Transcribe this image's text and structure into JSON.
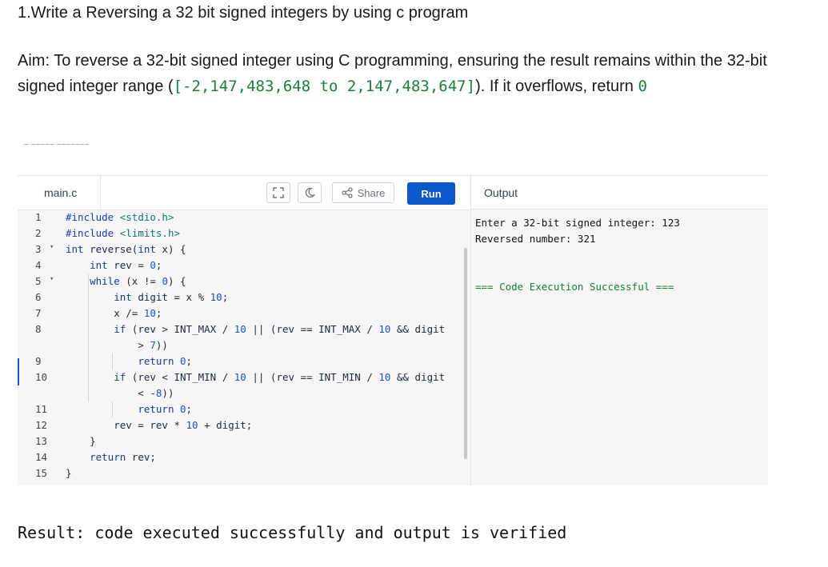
{
  "title": "1.Write a Reversing a 32 bit signed integers by using c program",
  "aim": {
    "prefix": "Aim: To reverse a 32-bit signed integer using C programming, ensuring the result remains within the 32-bit signed integer range (",
    "range_code": "[-2,147,483,648 to 2,147,483,647]",
    "middle": "). If it overflows, return ",
    "return_code": "0"
  },
  "editor": {
    "file_tab": "main.c",
    "share_label": "Share",
    "run_label": "Run",
    "output_label": "Output"
  },
  "code_lines": [
    {
      "n": "1",
      "text": "#include <stdio.h>"
    },
    {
      "n": "2",
      "text": "#include <limits.h>"
    },
    {
      "n": "3",
      "text": "int reverse(int x) {"
    },
    {
      "n": "4",
      "text": "    int rev = 0;"
    },
    {
      "n": "5",
      "text": "    while (x != 0) {"
    },
    {
      "n": "6",
      "text": "        int digit = x % 10;"
    },
    {
      "n": "7",
      "text": "        x /= 10;"
    },
    {
      "n": "8",
      "text": "        if (rev > INT_MAX / 10 || (rev == INT_MAX / 10 && digit"
    },
    {
      "n": "",
      "text": "            > 7))"
    },
    {
      "n": "9",
      "text": "            return 0;"
    },
    {
      "n": "10",
      "text": "        if (rev < INT_MIN / 10 || (rev == INT_MIN / 10 && digit"
    },
    {
      "n": "",
      "text": "            < -8))"
    },
    {
      "n": "11",
      "text": "            return 0;"
    },
    {
      "n": "12",
      "text": "        rev = rev * 10 + digit;"
    },
    {
      "n": "13",
      "text": "    }"
    },
    {
      "n": "14",
      "text": "    return rev;"
    },
    {
      "n": "15",
      "text": "}"
    }
  ],
  "output_lines": [
    "Enter a 32-bit signed integer: 123",
    "Reversed number: 321",
    "",
    "=== Code Execution Successful ==="
  ],
  "result": "Result: code executed successfully and output is verified"
}
